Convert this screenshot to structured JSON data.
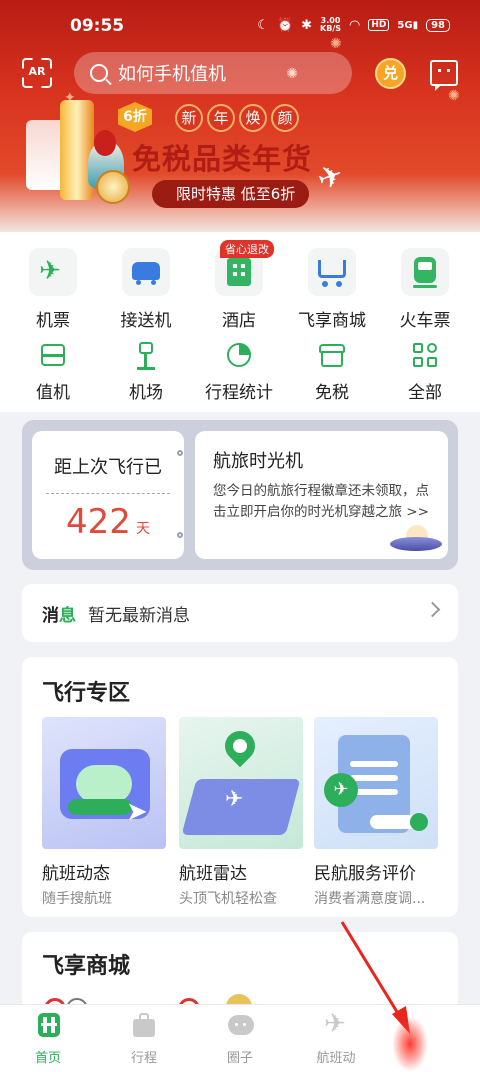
{
  "status_bar": {
    "time": "09:55",
    "net_speed_value": "3.00",
    "net_speed_unit": "KB/S",
    "hd": "HD",
    "signal": "5G",
    "battery": "98"
  },
  "header": {
    "ar_label": "AR",
    "search_placeholder": "如何手机值机",
    "coin_label": "兑"
  },
  "banner": {
    "discount_tag": "6折",
    "ribbon": [
      "新",
      "年",
      "焕",
      "颜"
    ],
    "title": "免税品类年货",
    "subtitle": "限时特惠 低至6折"
  },
  "services": {
    "row1": [
      {
        "label": "机票",
        "icon": "airplane-ticket-icon"
      },
      {
        "label": "接送机",
        "icon": "car-icon"
      },
      {
        "label": "酒店",
        "icon": "hotel-icon",
        "badge": "省心退改"
      },
      {
        "label": "飞享商城",
        "icon": "shopping-cart-icon"
      },
      {
        "label": "火车票",
        "icon": "train-icon"
      }
    ],
    "row2": [
      {
        "label": "值机",
        "icon": "check-in-icon"
      },
      {
        "label": "机场",
        "icon": "airport-icon"
      },
      {
        "label": "行程统计",
        "icon": "pie-chart-icon"
      },
      {
        "label": "免税",
        "icon": "duty-free-store-icon"
      },
      {
        "label": "全部",
        "icon": "grid-icon"
      }
    ]
  },
  "memory": {
    "left_title": "距上次飞行已",
    "days": "422",
    "days_unit": "天",
    "right_title": "航旅时光机",
    "right_desc": "您今日的航旅行程徽章还未领取，点击立即开启你的时光机穿越之旅 >>"
  },
  "news": {
    "label_part1": "消",
    "label_part2": "息",
    "text": "暂无最新消息"
  },
  "flight_zone": {
    "title": "飞行专区",
    "cards": [
      {
        "name": "航班动态",
        "sub": "随手搜航班"
      },
      {
        "name": "航班雷达",
        "sub": "头顶飞机轻松查"
      },
      {
        "name": "民航服务评价",
        "sub": "消费者满意度调..."
      }
    ]
  },
  "store": {
    "title": "飞享商城"
  },
  "bottom_nav": [
    {
      "label": "首页",
      "active": true
    },
    {
      "label": "行程",
      "active": false
    },
    {
      "label": "圈子",
      "active": false
    },
    {
      "label": "航班动",
      "active": false
    }
  ],
  "colors": {
    "brand_green": "#2dae5a",
    "header_red": "#d8331f",
    "accent_red": "#e04a3a"
  }
}
